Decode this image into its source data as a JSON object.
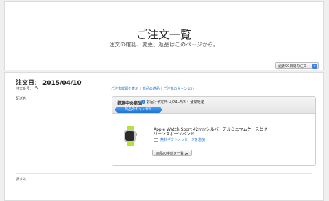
{
  "header": {
    "title": "ご注文一覧",
    "subtitle": "注文の確認、変更、返品はこのページから。",
    "period_select": "過去90日間の注文"
  },
  "order": {
    "date_label": "注文日：",
    "date_value": "2015/04/10",
    "number_label": "注文番号：",
    "number_value": "W",
    "links": [
      "ご注文詳細を表示",
      "商品の返品",
      "ご注文のキャンセル"
    ],
    "ship_to_label": "配送先：",
    "bill_to_label": "請求先："
  },
  "status": {
    "title": "処理中の商品",
    "info_icon": "i",
    "delivery": "お届け予定日: 4/24−5/8 ：通常配送",
    "cancel_button": "商品のキャンセル"
  },
  "product": {
    "name": "Apple Watch Sport 42mmシルバーアルミニウムケースとグリーンスポーツバンド",
    "gift_link": "無料ギフトメッセージを追加",
    "guide_select": "商品の手続き一覧",
    "band_color": "#b8e03a",
    "case_color": "#2b2b2b"
  },
  "colors": {
    "accent": "#1e74d8",
    "link": "#1a6fc9"
  }
}
